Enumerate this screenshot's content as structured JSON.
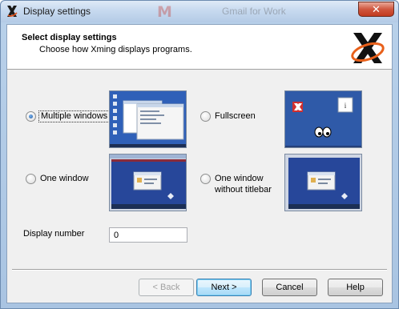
{
  "window": {
    "title": "Display settings",
    "close_label": "✕"
  },
  "background": {
    "gmail_text": "Gmail for Work"
  },
  "header": {
    "title": "Select display settings",
    "subtitle": "Choose how Xming displays programs."
  },
  "options": [
    {
      "label": "Multiple windows",
      "checked": true
    },
    {
      "label": "Fullscreen",
      "checked": false
    },
    {
      "label": "One window",
      "checked": false
    },
    {
      "label_line1": "One window",
      "label_line2": "without titlebar",
      "checked": false
    }
  ],
  "display_number": {
    "label": "Display number",
    "value": "0"
  },
  "buttons": {
    "back": "< Back",
    "next": "Next >",
    "cancel": "Cancel",
    "help": "Help"
  },
  "icons": {
    "app": "xming-x-icon",
    "logo": "xming-logo-icon",
    "close": "close-icon"
  },
  "colors": {
    "accent_blue": "#1d5aa6",
    "preview_desktop": "#2b4f9e",
    "xming_red": "#d02f2f"
  }
}
